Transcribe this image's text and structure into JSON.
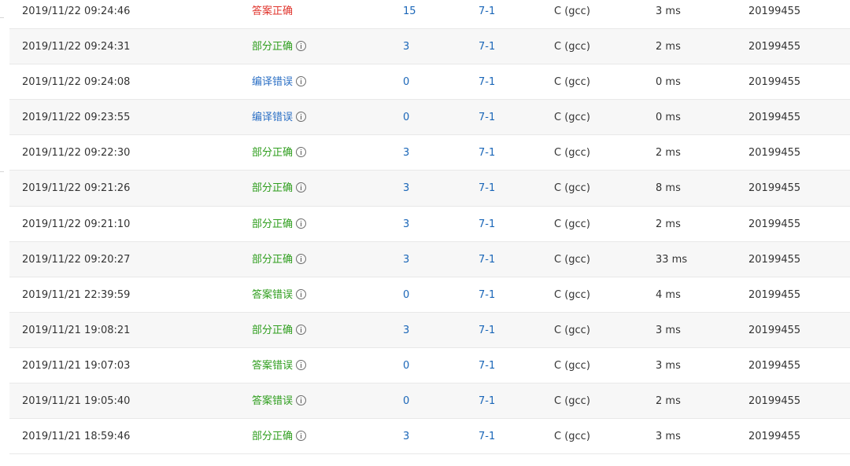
{
  "submissions": [
    {
      "time": "2019/11/22 09:24:46",
      "status": "答案正确",
      "status_type": "ac",
      "info": false,
      "score": "15",
      "problem": "7-1",
      "compiler": "C (gcc)",
      "cost": "3 ms",
      "user": "20199455"
    },
    {
      "time": "2019/11/22 09:24:31",
      "status": "部分正确",
      "status_type": "pa",
      "info": true,
      "score": "3",
      "problem": "7-1",
      "compiler": "C (gcc)",
      "cost": "2 ms",
      "user": "20199455"
    },
    {
      "time": "2019/11/22 09:24:08",
      "status": "编译错误",
      "status_type": "ce",
      "info": true,
      "score": "0",
      "problem": "7-1",
      "compiler": "C (gcc)",
      "cost": "0 ms",
      "user": "20199455"
    },
    {
      "time": "2019/11/22 09:23:55",
      "status": "编译错误",
      "status_type": "ce",
      "info": true,
      "score": "0",
      "problem": "7-1",
      "compiler": "C (gcc)",
      "cost": "0 ms",
      "user": "20199455"
    },
    {
      "time": "2019/11/22 09:22:30",
      "status": "部分正确",
      "status_type": "pa",
      "info": true,
      "score": "3",
      "problem": "7-1",
      "compiler": "C (gcc)",
      "cost": "2 ms",
      "user": "20199455"
    },
    {
      "time": "2019/11/22 09:21:26",
      "status": "部分正确",
      "status_type": "pa",
      "info": true,
      "score": "3",
      "problem": "7-1",
      "compiler": "C (gcc)",
      "cost": "8 ms",
      "user": "20199455"
    },
    {
      "time": "2019/11/22 09:21:10",
      "status": "部分正确",
      "status_type": "pa",
      "info": true,
      "score": "3",
      "problem": "7-1",
      "compiler": "C (gcc)",
      "cost": "2 ms",
      "user": "20199455"
    },
    {
      "time": "2019/11/22 09:20:27",
      "status": "部分正确",
      "status_type": "pa",
      "info": true,
      "score": "3",
      "problem": "7-1",
      "compiler": "C (gcc)",
      "cost": "33 ms",
      "user": "20199455"
    },
    {
      "time": "2019/11/21 22:39:59",
      "status": "答案错误",
      "status_type": "wa",
      "info": true,
      "score": "0",
      "problem": "7-1",
      "compiler": "C (gcc)",
      "cost": "4 ms",
      "user": "20199455"
    },
    {
      "time": "2019/11/21 19:08:21",
      "status": "部分正确",
      "status_type": "pa",
      "info": true,
      "score": "3",
      "problem": "7-1",
      "compiler": "C (gcc)",
      "cost": "3 ms",
      "user": "20199455"
    },
    {
      "time": "2019/11/21 19:07:03",
      "status": "答案错误",
      "status_type": "wa",
      "info": true,
      "score": "0",
      "problem": "7-1",
      "compiler": "C (gcc)",
      "cost": "3 ms",
      "user": "20199455"
    },
    {
      "time": "2019/11/21 19:05:40",
      "status": "答案错误",
      "status_type": "wa",
      "info": true,
      "score": "0",
      "problem": "7-1",
      "compiler": "C (gcc)",
      "cost": "2 ms",
      "user": "20199455"
    },
    {
      "time": "2019/11/21 18:59:46",
      "status": "部分正确",
      "status_type": "pa",
      "info": true,
      "score": "3",
      "problem": "7-1",
      "compiler": "C (gcc)",
      "cost": "3 ms",
      "user": "20199455"
    }
  ],
  "colors": {
    "accepted": "#e0332b",
    "partial": "#2f9e1e",
    "compile_error": "#2c70c5",
    "wrong_answer": "#2f9e1e",
    "link": "#1a66b8",
    "row_alt": "#f7f7f7",
    "divider": "#e8e8e8"
  },
  "icons": {
    "status_detail": "info-circle-icon"
  }
}
